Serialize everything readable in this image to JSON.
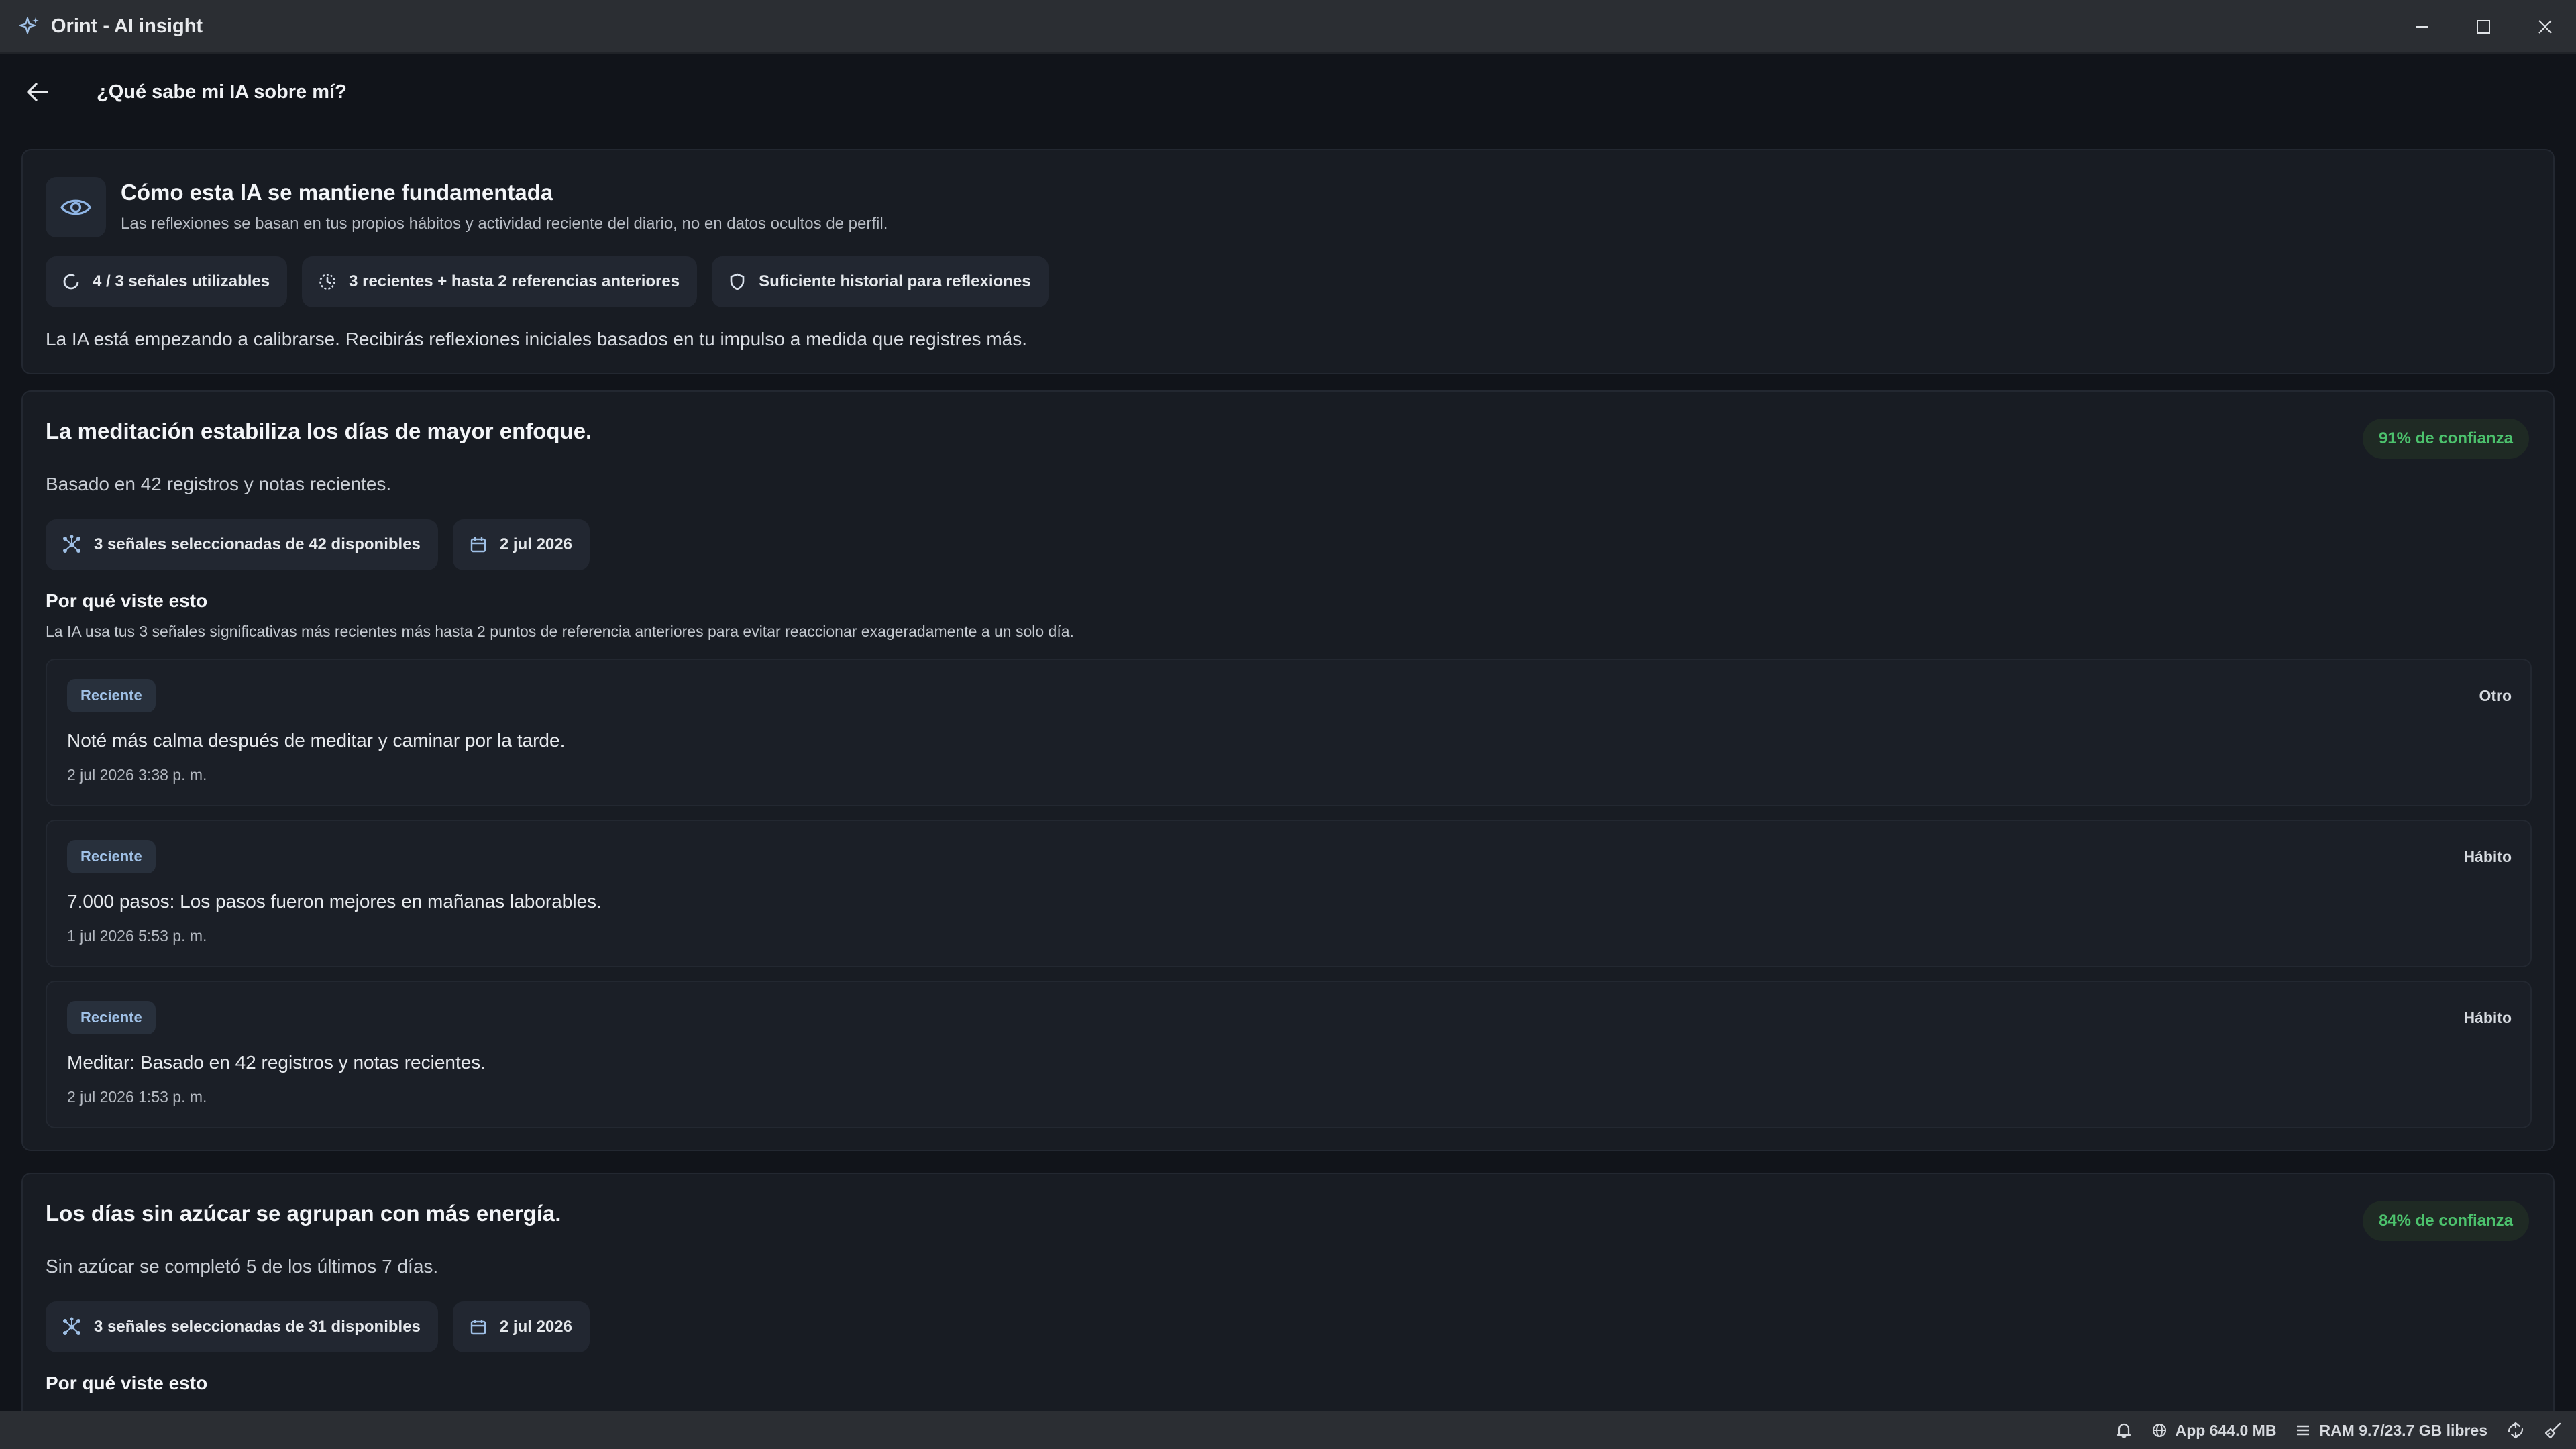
{
  "window": {
    "title": "Orint - AI insight",
    "icons": {
      "app": "sparkle-icon",
      "minimize": "minimize-icon",
      "maximize": "maximize-icon",
      "close": "close-icon"
    }
  },
  "header": {
    "back_icon": "arrow-left-icon",
    "title": "¿Qué sabe mi IA sobre mí?"
  },
  "grounding": {
    "icon": "eye-icon",
    "title": "Cómo esta IA se mantiene fundamentada",
    "subtitle": "Las reflexiones se basan en tus propios hábitos y actividad reciente del diario, no en datos ocultos de perfil.",
    "chips": [
      {
        "icon": "circle-progress-icon",
        "label": "4 / 3 señales utilizables"
      },
      {
        "icon": "clock-icon",
        "label": "3 recientes + hasta 2 referencias anteriores"
      },
      {
        "icon": "shield-icon",
        "label": "Suficiente historial para reflexiones"
      }
    ],
    "note": "La IA está empezando a calibrarse. Recibirás reflexiones iniciales basados en tu impulso a medida que registres más."
  },
  "insights": [
    {
      "title": "La meditación estabiliza los días de mayor enfoque.",
      "confidence": "91% de confianza",
      "description": "Basado en 42 registros y notas recientes.",
      "signals_chip": "3 señales seleccionadas de 42 disponibles",
      "date_chip": "2 jul 2026",
      "why_title": "Por qué viste esto",
      "why_text": "La IA usa tus 3 señales significativas más recientes más hasta 2 puntos de referencia anteriores para evitar reaccionar exageradamente a un solo día.",
      "signals": [
        {
          "tag": "Reciente",
          "kind": "Otro",
          "text": "Noté más calma después de meditar y caminar por la tarde.",
          "date": "2 jul 2026 3:38 p. m."
        },
        {
          "tag": "Reciente",
          "kind": "Hábito",
          "text": "7.000 pasos: Los pasos fueron mejores en mañanas laborables.",
          "date": "1 jul 2026 5:53 p. m."
        },
        {
          "tag": "Reciente",
          "kind": "Hábito",
          "text": "Meditar: Basado en 42 registros y notas recientes.",
          "date": "2 jul 2026 1:53 p. m."
        }
      ]
    },
    {
      "title": "Los días sin azúcar se agrupan con más energía.",
      "confidence": "84% de confianza",
      "description": "Sin azúcar se completó 5 de los últimos 7 días.",
      "signals_chip": "3 señales seleccionadas de 31 disponibles",
      "date_chip": "2 jul 2026",
      "why_title": "Por qué viste esto"
    }
  ],
  "statusbar": {
    "bell_icon": "bell-icon",
    "app_memory": "App 644.0 MB",
    "ram": "RAM 9.7/23.7 GB libres",
    "recycle_icon": "recycle-icon",
    "broom_icon": "broom-icon"
  },
  "colors": {
    "confidence": "#4cc26d",
    "tag": "#9fc0e6",
    "background": "#11141a",
    "card": "#181c23"
  }
}
